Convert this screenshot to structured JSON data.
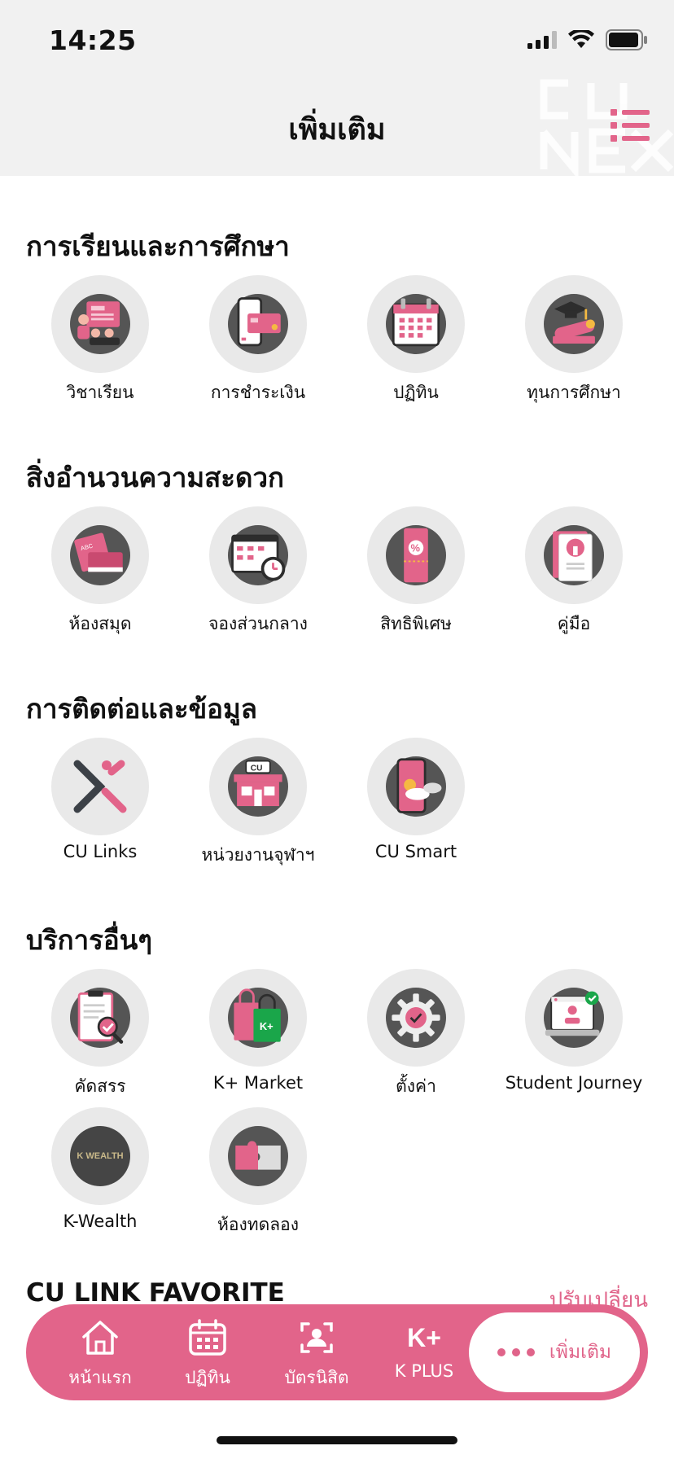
{
  "status": {
    "time": "14:25"
  },
  "header": {
    "title": "เพิ่มเติม",
    "watermark": "CU NEX"
  },
  "sections": [
    {
      "title": "การเรียนและการศึกษา",
      "items": [
        {
          "label": "วิชาเรียน",
          "icon": "classroom-icon"
        },
        {
          "label": "การชำระเงิน",
          "icon": "payment-icon"
        },
        {
          "label": "ปฏิทิน",
          "icon": "calendar-icon"
        },
        {
          "label": "ทุนการศึกษา",
          "icon": "scholarship-icon"
        }
      ]
    },
    {
      "title": "สิ่งอำนวนความสะดวก",
      "items": [
        {
          "label": "ห้องสมุด",
          "icon": "library-icon"
        },
        {
          "label": "จองส่วนกลาง",
          "icon": "booking-icon"
        },
        {
          "label": "สิทธิพิเศษ",
          "icon": "privilege-icon"
        },
        {
          "label": "คู่มือ",
          "icon": "manual-icon"
        }
      ]
    },
    {
      "title": "การติดต่อและข้อมูล",
      "items": [
        {
          "label": "CU Links",
          "icon": "cu-links-icon"
        },
        {
          "label": "หน่วยงานจุฬาฯ",
          "icon": "cu-store-icon"
        },
        {
          "label": "CU Smart",
          "icon": "cu-smart-icon"
        }
      ]
    },
    {
      "title": "บริการอื่นๆ",
      "items": [
        {
          "label": "คัดสรร",
          "icon": "selection-icon"
        },
        {
          "label": "K+ Market",
          "icon": "k-market-icon"
        },
        {
          "label": "ตั้งค่า",
          "icon": "settings-icon"
        },
        {
          "label": "Student Journey",
          "icon": "student-journey-icon"
        },
        {
          "label": "K-Wealth",
          "icon": "k-wealth-icon",
          "badge": "K WEALTH"
        },
        {
          "label": "ห้องทดลอง",
          "icon": "lab-icon"
        }
      ]
    }
  ],
  "favorites": {
    "title": "CU LINK FAVORITE",
    "change": "ปรับเปลี่ยน"
  },
  "tabbar": {
    "tabs": [
      {
        "label": "หน้าแรก",
        "icon": "home-icon"
      },
      {
        "label": "ปฏิทิน",
        "icon": "calendar-tab-icon"
      },
      {
        "label": "บัตรนิสิต",
        "icon": "student-card-icon"
      },
      {
        "label": "K PLUS",
        "icon": "k-plus-icon",
        "glyph": "K+"
      }
    ],
    "more": {
      "label": "เพิ่มเติม",
      "icon": "more-dots-icon"
    }
  },
  "colors": {
    "accent": "#e2648a",
    "icon_bg": "#555555",
    "circle_bg": "#e9e9e9"
  }
}
